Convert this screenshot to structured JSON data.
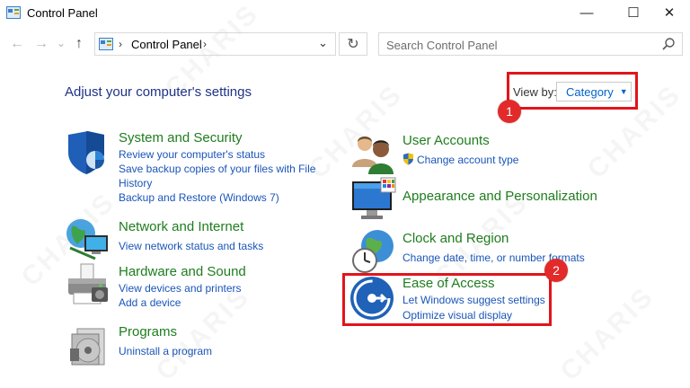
{
  "window": {
    "title": "Control Panel",
    "minimize": "—",
    "maximize": "☐",
    "close": "✕"
  },
  "nav": {
    "back": "←",
    "forward": "→",
    "recent": "⌄",
    "up": "↑"
  },
  "address": {
    "sep1": "›",
    "path": "Control Panel",
    "sep2": "›",
    "dropdown": "⌄",
    "refresh": "↻"
  },
  "search": {
    "placeholder": "Search Control Panel"
  },
  "main": {
    "heading": "Adjust your computer's settings",
    "view_by_label": "View by:",
    "view_by_value": "Category"
  },
  "markers": [
    "1",
    "2"
  ],
  "categories": {
    "system": {
      "title": "System and Security",
      "links": [
        "Review your computer's status",
        "Save backup copies of your files with File",
        "History",
        "Backup and Restore (Windows 7)"
      ]
    },
    "network": {
      "title": "Network and Internet",
      "links": [
        "View network status and tasks"
      ]
    },
    "hardware": {
      "title": "Hardware and Sound",
      "links": [
        "View devices and printers",
        "Add a device"
      ]
    },
    "programs": {
      "title": "Programs",
      "links": [
        "Uninstall a program"
      ]
    },
    "users": {
      "title": "User Accounts",
      "links": [
        "Change account type"
      ]
    },
    "appearance": {
      "title": "Appearance and Personalization",
      "links": []
    },
    "clock": {
      "title": "Clock and Region",
      "links": [
        "Change date, time, or number formats"
      ]
    },
    "ease": {
      "title": "Ease of Access",
      "links": [
        "Let Windows suggest settings",
        "Optimize visual display"
      ]
    }
  },
  "watermark": "CHARIS",
  "colors": {
    "heading": "#1e3287",
    "category_title": "#1e7d1e",
    "link": "#1a55b8",
    "highlight": "#e3141b",
    "marker": "#e22a2a"
  }
}
